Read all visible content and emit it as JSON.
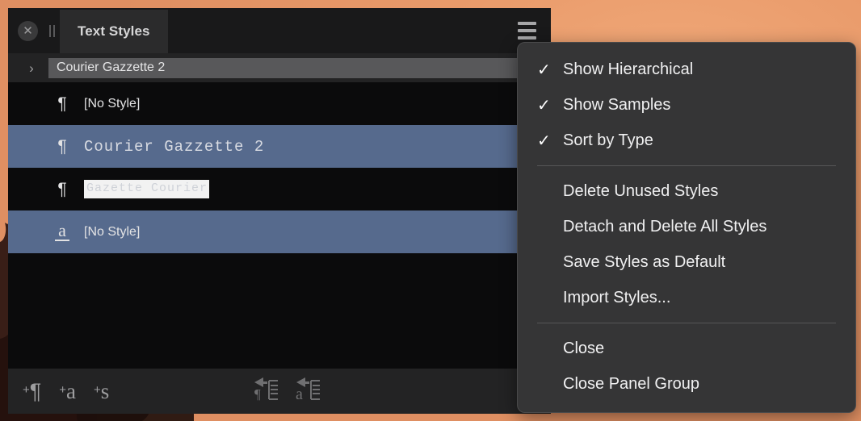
{
  "panel": {
    "titlebar": {
      "close_icon": "close-circle-icon",
      "drag_handle_icon": "pause-bars-icon",
      "tab_label": "Text Styles",
      "menu_icon": "hamburger-menu-icon"
    },
    "group": {
      "disclosure_icon": "›",
      "name": "Courier Gazzette 2"
    },
    "rows": [
      {
        "icon": "¶",
        "icon_name": "paragraph-style-icon",
        "label": "[No Style]",
        "selected": false,
        "editing": false,
        "mono": false
      },
      {
        "icon": "¶",
        "icon_name": "paragraph-style-icon",
        "label": "Courier Gazzette 2",
        "selected": true,
        "editing": false,
        "mono": true
      },
      {
        "icon": "¶",
        "icon_name": "paragraph-style-icon",
        "label": "Gazette Courier",
        "selected": false,
        "editing": true,
        "mono": true
      },
      {
        "icon": "a",
        "icon_name": "character-style-icon",
        "label": "[No Style]",
        "selected": true,
        "editing": false,
        "mono": false
      }
    ],
    "toolbar": {
      "new_paragraph_style": "¶",
      "new_character_style": "a",
      "new_section_style": "s",
      "plus": "+",
      "apply_paragraph_style_icon": "apply-paragraph-style-icon",
      "apply_character_style_icon": "apply-character-style-icon"
    }
  },
  "menu": {
    "checkmark": "✓",
    "items": [
      {
        "label": "Show Hierarchical",
        "checked": true
      },
      {
        "label": "Show Samples",
        "checked": true
      },
      {
        "label": "Sort by Type",
        "checked": true
      },
      {
        "label": "Delete Unused Styles",
        "checked": false
      },
      {
        "label": "Detach and Delete All Styles",
        "checked": false
      },
      {
        "label": "Save Styles as Default",
        "checked": false
      },
      {
        "label": "Import Styles...",
        "checked": false
      },
      {
        "label": "Close",
        "checked": false
      },
      {
        "label": "Close Panel Group",
        "checked": false
      }
    ]
  },
  "colors": {
    "desktop": "#e8996a",
    "panel_bg": "#0b0b0c",
    "titlebar": "#19191a",
    "tab_active": "#2b2b2c",
    "row_selected": "#566a8d",
    "toolbar": "#232324",
    "menu_bg": "#353536",
    "group_pill": "#58585a"
  }
}
